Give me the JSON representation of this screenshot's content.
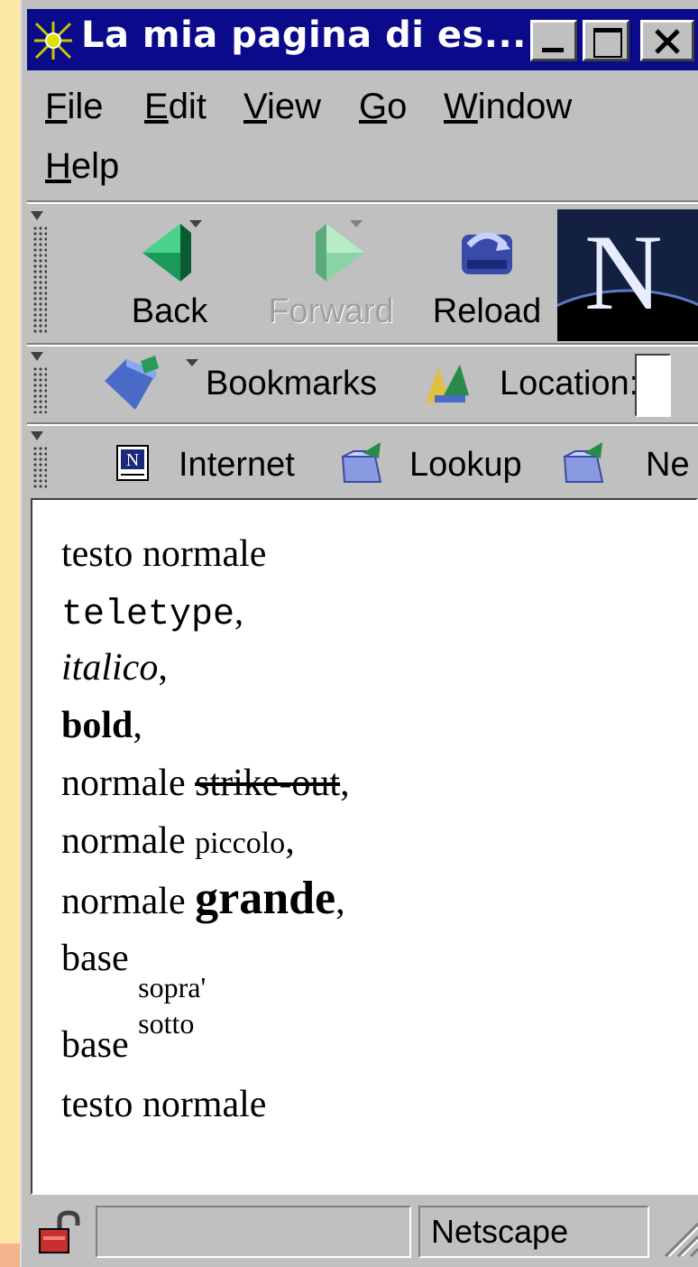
{
  "window": {
    "title": "La mia pagina di es...",
    "controls": {
      "minimize": "_",
      "maximize": "□",
      "close": "×"
    }
  },
  "menu": [
    {
      "label": "File"
    },
    {
      "label": "Edit"
    },
    {
      "label": "View"
    },
    {
      "label": "Go"
    },
    {
      "label": "Window"
    },
    {
      "label": "Help"
    }
  ],
  "nav_toolbar": {
    "back": "Back",
    "forward": "Forward",
    "reload": "Reload",
    "logo_letter": "N"
  },
  "location_toolbar": {
    "bookmarks": "Bookmarks",
    "location": "Location:",
    "location_value": ""
  },
  "personal_toolbar": {
    "items": [
      "Internet",
      "Lookup",
      "Ne"
    ]
  },
  "content": {
    "lines": [
      {
        "style": "normal",
        "text": "testo normale"
      },
      {
        "style": "teletype",
        "text": "teletype",
        "suffix": ","
      },
      {
        "style": "italic",
        "text": "italico",
        "suffix": ","
      },
      {
        "style": "bold",
        "text": "bold",
        "suffix": ","
      },
      {
        "style": "strike",
        "prefix": "normale ",
        "text": "strike-out",
        "suffix": ","
      },
      {
        "style": "small",
        "prefix": "normale ",
        "text": "piccolo",
        "suffix": ","
      },
      {
        "style": "big",
        "prefix": "normale ",
        "text": "grande",
        "suffix": ","
      },
      {
        "style": "sub",
        "prefix": "base ",
        "text": "sopra'"
      },
      {
        "style": "sup",
        "prefix": "base ",
        "text": "sotto"
      },
      {
        "style": "normal",
        "text": "testo normale"
      }
    ]
  },
  "status": {
    "text": "Netscape"
  },
  "colors": {
    "titlebar": "#0a0a8a",
    "chrome": "#c0c0c0",
    "page_background": "#ffffff"
  }
}
